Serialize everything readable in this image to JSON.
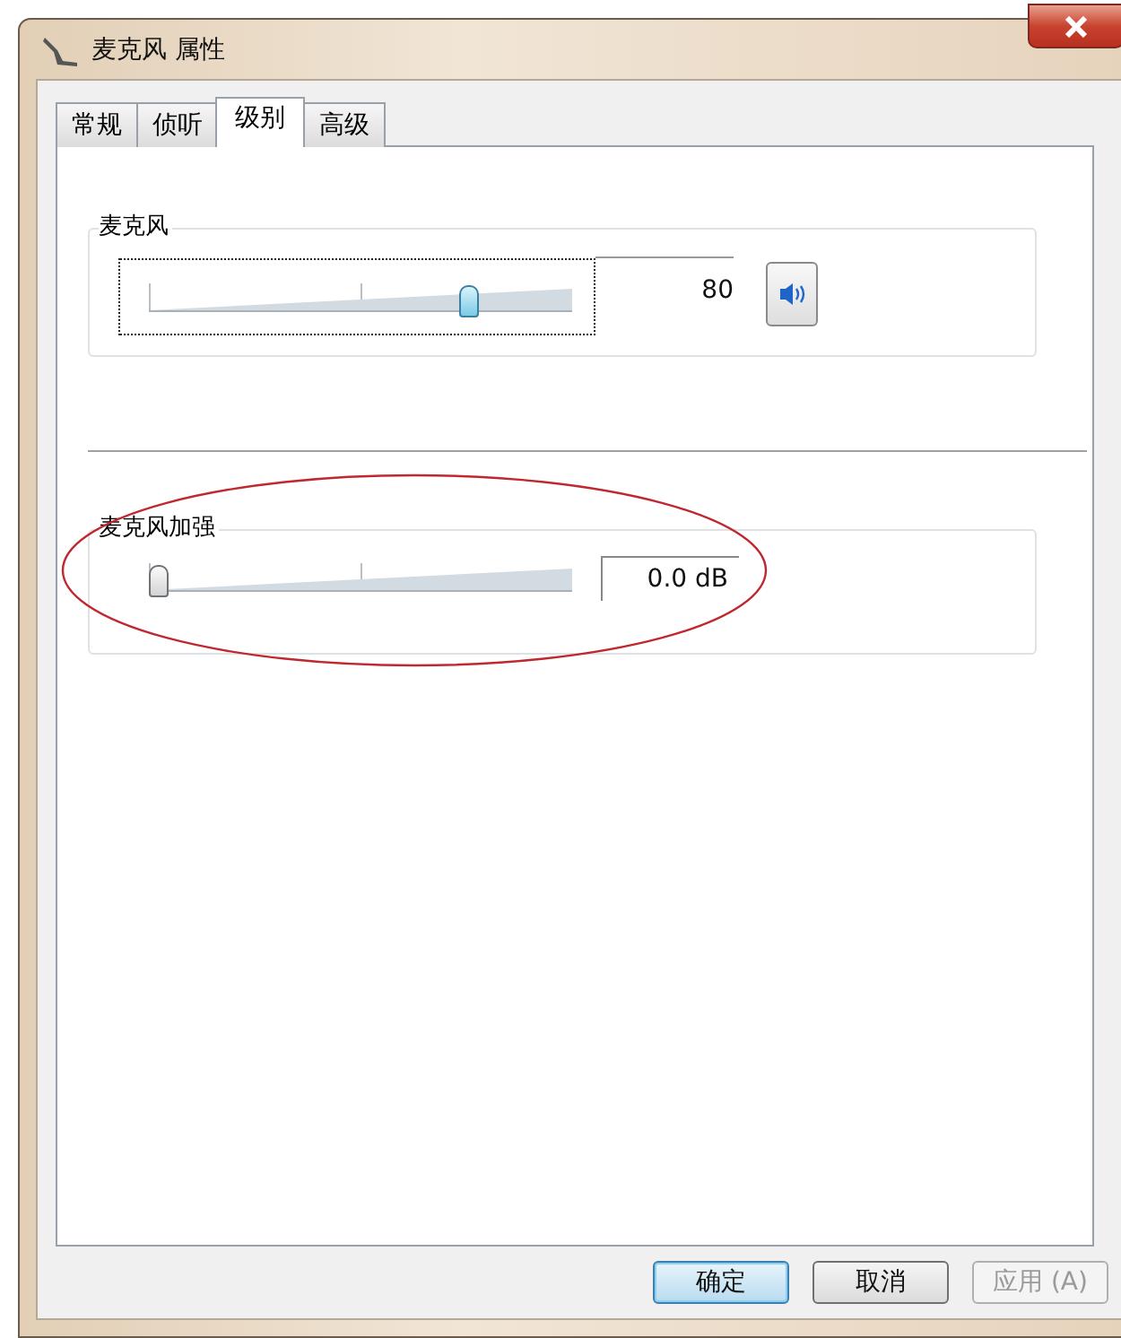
{
  "window": {
    "title": "麦克风 属性"
  },
  "tabs": [
    {
      "label": "常规",
      "selected": false
    },
    {
      "label": "侦听",
      "selected": false
    },
    {
      "label": "级别",
      "selected": true
    },
    {
      "label": "高级",
      "selected": false
    }
  ],
  "groups": [
    {
      "label": "麦克风",
      "level": 0.8,
      "reading": "80",
      "kind": "volume",
      "focused": true
    },
    {
      "label": "麦克风加强",
      "level": 0,
      "reading": "0.0 dB",
      "kind": "boost",
      "focused": false
    }
  ],
  "buttons": [
    {
      "label": "确定",
      "default": true,
      "disabled": false
    },
    {
      "label": "取消",
      "default": false,
      "disabled": false
    },
    {
      "label": "应用 (A)",
      "default": false,
      "disabled": true
    }
  ]
}
